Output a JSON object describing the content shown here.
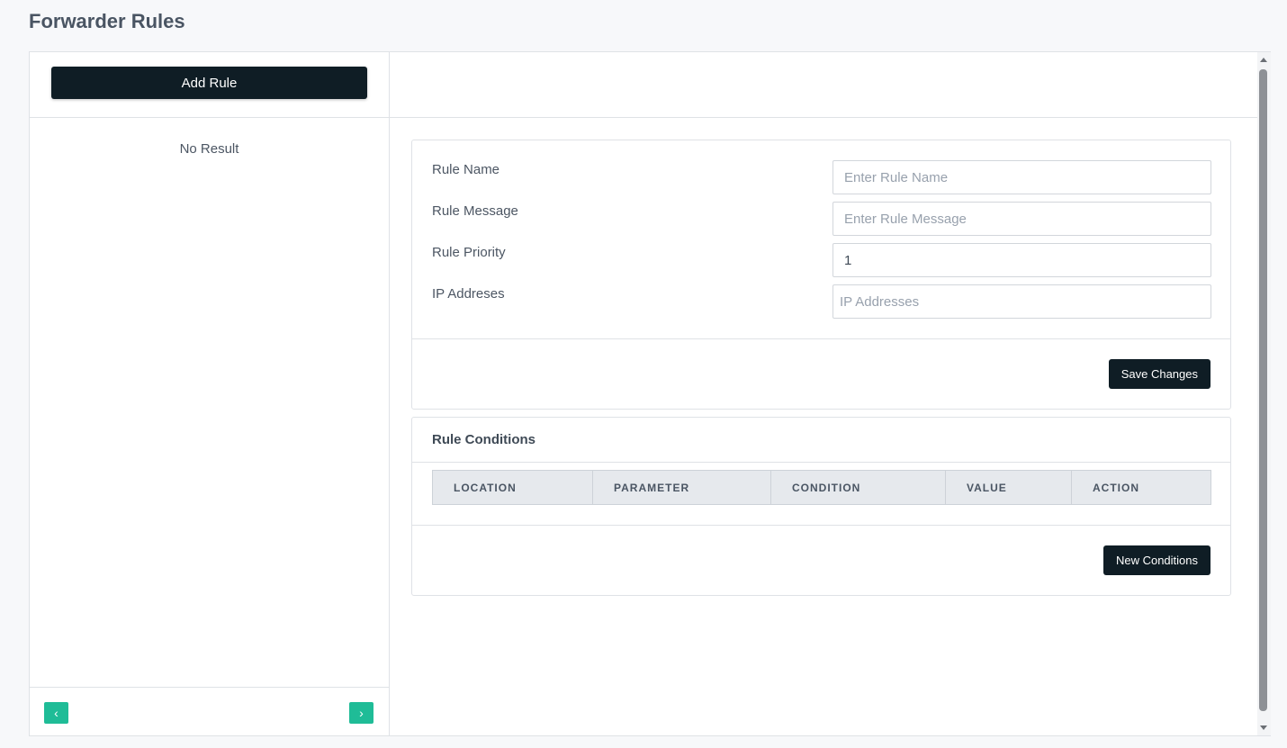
{
  "page": {
    "title": "Forwarder Rules"
  },
  "sidebar": {
    "add_rule_label": "Add Rule",
    "empty_text": "No Result",
    "prev_icon": "‹",
    "next_icon": "›"
  },
  "form": {
    "rule_name": {
      "label": "Rule Name",
      "placeholder": "Enter Rule Name",
      "value": ""
    },
    "rule_message": {
      "label": "Rule Message",
      "placeholder": "Enter Rule Message",
      "value": ""
    },
    "rule_priority": {
      "label": "Rule Priority",
      "placeholder": "",
      "value": "1"
    },
    "ip_addresses": {
      "label": "IP Addreses",
      "placeholder": "IP Addresses",
      "value": ""
    },
    "save_label": "Save Changes"
  },
  "conditions": {
    "title": "Rule Conditions",
    "columns": [
      "LOCATION",
      "PARAMETER",
      "CONDITION",
      "VALUE",
      "ACTION"
    ],
    "new_label": "New Conditions"
  },
  "colors": {
    "primary_dark": "#0f1d25",
    "accent_green": "#1fbc97",
    "header_bg": "#e6e9ed"
  }
}
